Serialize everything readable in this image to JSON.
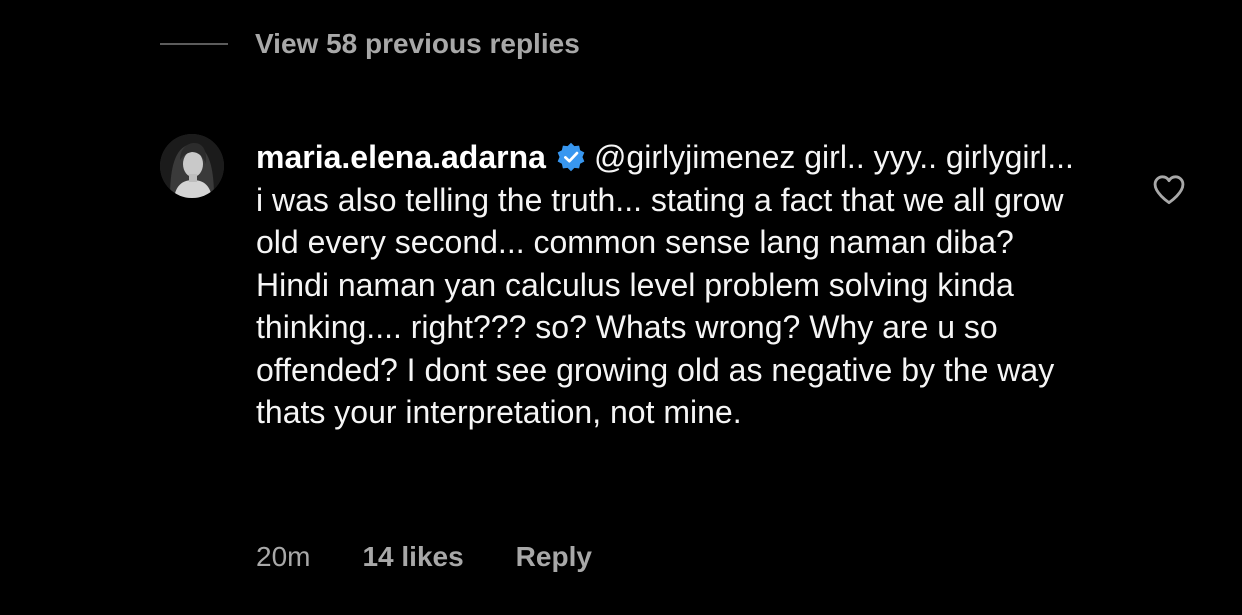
{
  "thread": {
    "view_replies_label": "View 58 previous replies"
  },
  "comment": {
    "username": "maria.elena.adarna",
    "verified": true,
    "mention": "@girlyjimenez",
    "text": " girl.. yyy.. girlygirl... i was also telling the truth... stating a fact that we all grow old every second... common sense lang naman diba? Hindi naman yan calculus level problem solving kinda thinking.... right??? so? Whats wrong? Why are u so offended? I dont see growing old as negative by the way thats your interpretation, not mine.",
    "time": "20m",
    "likes": "14 likes",
    "reply_label": "Reply",
    "like_icon": "heart-outline-icon"
  },
  "colors": {
    "background": "#000000",
    "secondary_text": "#a8a8a8",
    "verified_badge": "#3897f0"
  }
}
